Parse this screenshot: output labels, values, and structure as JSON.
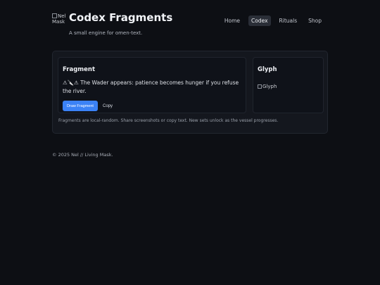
{
  "header": {
    "logo_alt": "Nel Mask",
    "title": "Codex Fragments",
    "tagline": "A small engine for omen-text."
  },
  "nav": {
    "items": [
      {
        "label": "Home",
        "active": false
      },
      {
        "label": "Codex",
        "active": true
      },
      {
        "label": "Rituals",
        "active": false
      },
      {
        "label": "Shop",
        "active": false
      }
    ]
  },
  "fragment": {
    "title": "Fragment",
    "text": "⚠🔪⚠ The Wader appears: patience becomes hunger if you refuse the river.",
    "draw_label": "Draw Fragment",
    "copy_label": "Copy"
  },
  "glyph": {
    "title": "Glyph",
    "image_alt": "Glyph"
  },
  "note": "Fragments are local-random. Share screenshots or copy text. New sets unlock as the vessel progresses.",
  "footer": "© 2025 Nel // Living Mask.",
  "colors": {
    "background": "#0d0f14",
    "panel": "#14171e",
    "accent": "#3b82f6",
    "nav_active": "#2a2e37"
  }
}
